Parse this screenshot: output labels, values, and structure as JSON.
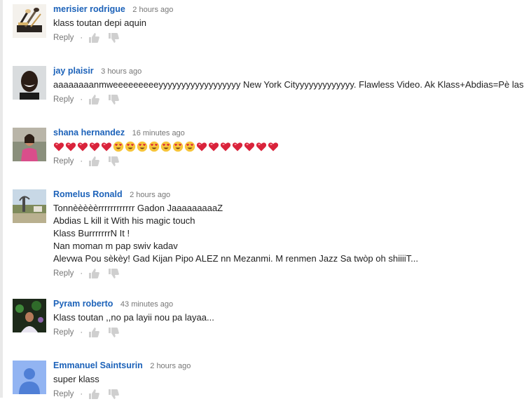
{
  "comments": [
    {
      "author": "merisier rodrigue",
      "time": "2 hours ago",
      "lines": [
        "klass toutan depi aquin"
      ],
      "reply_label": "Reply",
      "avatar": "makeup-brushes-photo"
    },
    {
      "author": "jay plaisir",
      "time": "3 hours ago",
      "lines": [
        "aaaaaaaanmweeeeeeeeeyyyyyyyyyyyyyyyyyy New York Cityyyyyyyyyyyyy. Flawless Video.  Ak Klass+Abdias=Pè las."
      ],
      "reply_label": "Reply",
      "avatar": "smiling-man-photo"
    },
    {
      "author": "shana hernandez",
      "time": "16 minutes ago",
      "emojis": [
        "heart",
        "heart",
        "heart",
        "heart",
        "heart",
        "heart-eyes",
        "heart-eyes",
        "heart-eyes",
        "heart-eyes",
        "heart-eyes",
        "heart-eyes",
        "heart-eyes",
        "heart",
        "heart",
        "heart",
        "heart",
        "heart",
        "heart",
        "heart"
      ],
      "reply_label": "Reply",
      "avatar": "woman-photo"
    },
    {
      "author": "Romelus Ronald",
      "time": "2 hours ago",
      "lines": [
        "Tonnèèèèèrrrrrrrrrrrr Gadon JaaaaaaaaaZ",
        "Abdias L kill it With his magic touch",
        "Klass BurrrrrrrN It !",
        "Nan moman m pap swiv kadav",
        "Alevwa Pou sèkèy! Gad Kijan Pipo ALEZ nn Mezanmi. M renmen Jazz Sa twòp oh shiiiiT..."
      ],
      "reply_label": "Reply",
      "avatar": "landscape-photo"
    },
    {
      "author": "Pyram roberto",
      "time": "43 minutes ago",
      "lines": [
        "Klass toutan ,,no pa layii nou pa layaa..."
      ],
      "reply_label": "Reply",
      "avatar": "party-photo"
    },
    {
      "author": "Emmanuel Saintsurin",
      "time": "2 hours ago",
      "lines": [
        "super klass"
      ],
      "reply_label": "Reply",
      "avatar": "default-user-avatar"
    }
  ],
  "separator": "·",
  "colors": {
    "author": "#1c62b9",
    "meta": "#767676",
    "heart": "#d9233b",
    "default_avatar_bg": "#92b4f2",
    "default_avatar_fg": "#4f7fd6"
  }
}
